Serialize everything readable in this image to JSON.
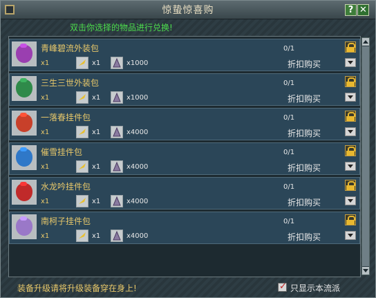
{
  "window": {
    "title": "惊蛰惊喜购",
    "subtitle": "双击你选择的物品进行兑换!",
    "help_label": "?",
    "close_label": "✕"
  },
  "items": [
    {
      "name": "青峰碧流外装包",
      "quantity": "x1",
      "cost1": "x1",
      "cost2": "x1000",
      "progress": "0/1",
      "buy_label": "折扣购买",
      "icon": "purple-bag-icon",
      "color": "#9a3fb0"
    },
    {
      "name": "三生三世外装包",
      "quantity": "x1",
      "cost1": "x1",
      "cost2": "x1000",
      "progress": "0/1",
      "buy_label": "折扣购买",
      "icon": "green-bag-icon",
      "color": "#2f8a4a"
    },
    {
      "name": "一落春挂件包",
      "quantity": "x1",
      "cost1": "x1",
      "cost2": "x4000",
      "progress": "0/1",
      "buy_label": "折扣购买",
      "icon": "red-bag-icon",
      "color": "#c8402a"
    },
    {
      "name": "催雪挂件包",
      "quantity": "x1",
      "cost1": "x1",
      "cost2": "x4000",
      "progress": "0/1",
      "buy_label": "折扣购买",
      "icon": "blue-bag-icon",
      "color": "#2f78c8"
    },
    {
      "name": "水龙吟挂件包",
      "quantity": "x1",
      "cost1": "x1",
      "cost2": "x4000",
      "progress": "0/1",
      "buy_label": "折扣购买",
      "icon": "red-bag-icon",
      "color": "#c02a2a"
    },
    {
      "name": "南柯子挂件包",
      "quantity": "x1",
      "cost1": "x1",
      "cost2": "x4000",
      "progress": "0/1",
      "buy_label": "折扣购买",
      "icon": "lilac-bag-icon",
      "color": "#9a78c8"
    }
  ],
  "footer": {
    "notice": "装备升级请将升级装备穿在身上!",
    "filter_label": "只显示本流派",
    "filter_checked": true
  }
}
